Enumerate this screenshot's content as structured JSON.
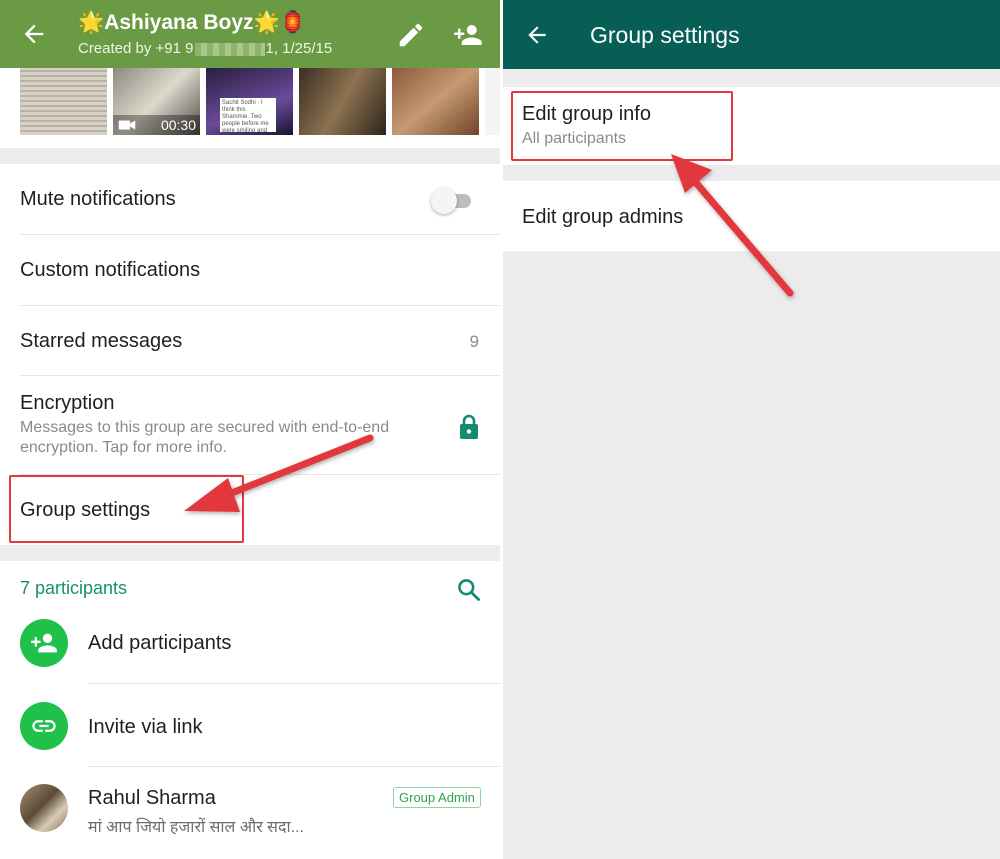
{
  "left": {
    "header": {
      "title": "🌟Ashiyana Boyz🌟🏮",
      "subtitle_prefix": "Created by +91 9",
      "subtitle_suffix": "1, 1/25/15",
      "colors": {
        "header_bg": "#6b9a44"
      }
    },
    "media": {
      "video_duration": "00:30",
      "thumb_text": "Sachit Sodhi · I think this Shammie. Two people before me were smiling and one of them was pointing at St. George and saying 'Its what recipe?'"
    },
    "settings": {
      "mute_label": "Mute notifications",
      "mute_enabled": false,
      "custom_label": "Custom notifications",
      "starred_label": "Starred messages",
      "starred_count": "9",
      "encryption_label": "Encryption",
      "encryption_desc": "Messages to this group are secured with end-to-end encryption. Tap for more info.",
      "group_settings_label": "Group settings"
    },
    "participants": {
      "title": "7 participants",
      "add_label": "Add participants",
      "invite_label": "Invite via link",
      "member": {
        "name": "Rahul Sharma",
        "status": "मां आप जियो हजारों साल और सदा...",
        "badge": "Group Admin"
      }
    }
  },
  "right": {
    "header": {
      "title": "Group settings",
      "colors": {
        "header_bg": "#075e54"
      }
    },
    "items": [
      {
        "label": "Edit group info",
        "sub": "All participants"
      },
      {
        "label": "Edit group admins"
      }
    ]
  },
  "accent_colors": {
    "annotation_red": "#e2383d",
    "whatsapp_green": "#1fc14a",
    "teal_text": "#17906f"
  }
}
